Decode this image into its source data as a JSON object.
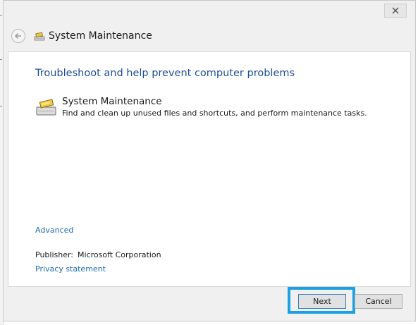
{
  "window": {
    "title": "System Maintenance"
  },
  "content": {
    "heading": "Troubleshoot and help prevent computer problems",
    "item": {
      "title": "System Maintenance",
      "description": "Find and clean up unused files and shortcuts, and perform maintenance tasks."
    },
    "advanced_link": "Advanced",
    "publisher_label": "Publisher:",
    "publisher_value": "Microsoft Corporation",
    "privacy_link": "Privacy statement"
  },
  "footer": {
    "next_label": "Next",
    "cancel_label": "Cancel"
  },
  "icons": {
    "close": "close-icon",
    "back": "back-arrow-icon",
    "title": "maintenance-icon",
    "item": "maintenance-icon"
  },
  "colors": {
    "heading": "#1e4d96",
    "link": "#1c6ab0",
    "highlight": "#1ba1e2"
  }
}
